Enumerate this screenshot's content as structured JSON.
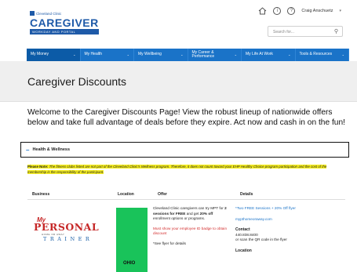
{
  "header": {
    "org": "Cleveland Clinic",
    "brand": "CAREGIVER",
    "tagline": "WORKDAY AND PORTAL",
    "user": "Craig Anschuetz",
    "search_placeholder": "Search for..."
  },
  "nav": [
    {
      "label": "My Money"
    },
    {
      "label": "My Health"
    },
    {
      "label": "My Wellbeing"
    },
    {
      "label": "My Career & Performance"
    },
    {
      "label": "My Life At Work"
    },
    {
      "label": "Tools & Resources"
    }
  ],
  "page_title": "Caregiver Discounts",
  "welcome": "Welcome to the Caregiver Discounts Page! View the robust lineup of nationwide offers below and take full advantage of deals before they expire. Act now and cash in on the fun!",
  "accordion": {
    "label": "Health & Wellness",
    "toggle": "–"
  },
  "note": {
    "label": "Please Note:",
    "text": "The fitness clubs listed are not part of the Cleveland Clinic's Wellness program. Therefore, it does not count toward your EHP Healthy Choice program participation and the cost of the membership is the responsibility of the participant."
  },
  "table": {
    "headers": [
      "Business",
      "Location",
      "Offer",
      "Details"
    ],
    "row": {
      "logo_my": "My",
      "logo_main": "PERSONAL",
      "logo_sub": "HOME OR AWAY",
      "logo_bottom": "TRAINER",
      "location": "OHIO",
      "offer_p1_a": "Cleveland Clinic caregivers can try MPT for ",
      "offer_p1_b": "2 sessions for FREE",
      "offer_p1_c": " and get ",
      "offer_p1_d": "20% off",
      "offer_p1_e": " enrollment options or programs.",
      "offer_red": "Must show your employee ID badge to obtain discount",
      "offer_p3": "*See flyer for details",
      "detail_link": "*Two FREE Sessions + 20% Off flyer",
      "detail_site": "mypthomeoraway.com",
      "contact_label": "Contact",
      "contact_phone": "440.838.8400",
      "contact_qr": "or scan the QR code in the flyer",
      "location_label": "Location"
    }
  }
}
